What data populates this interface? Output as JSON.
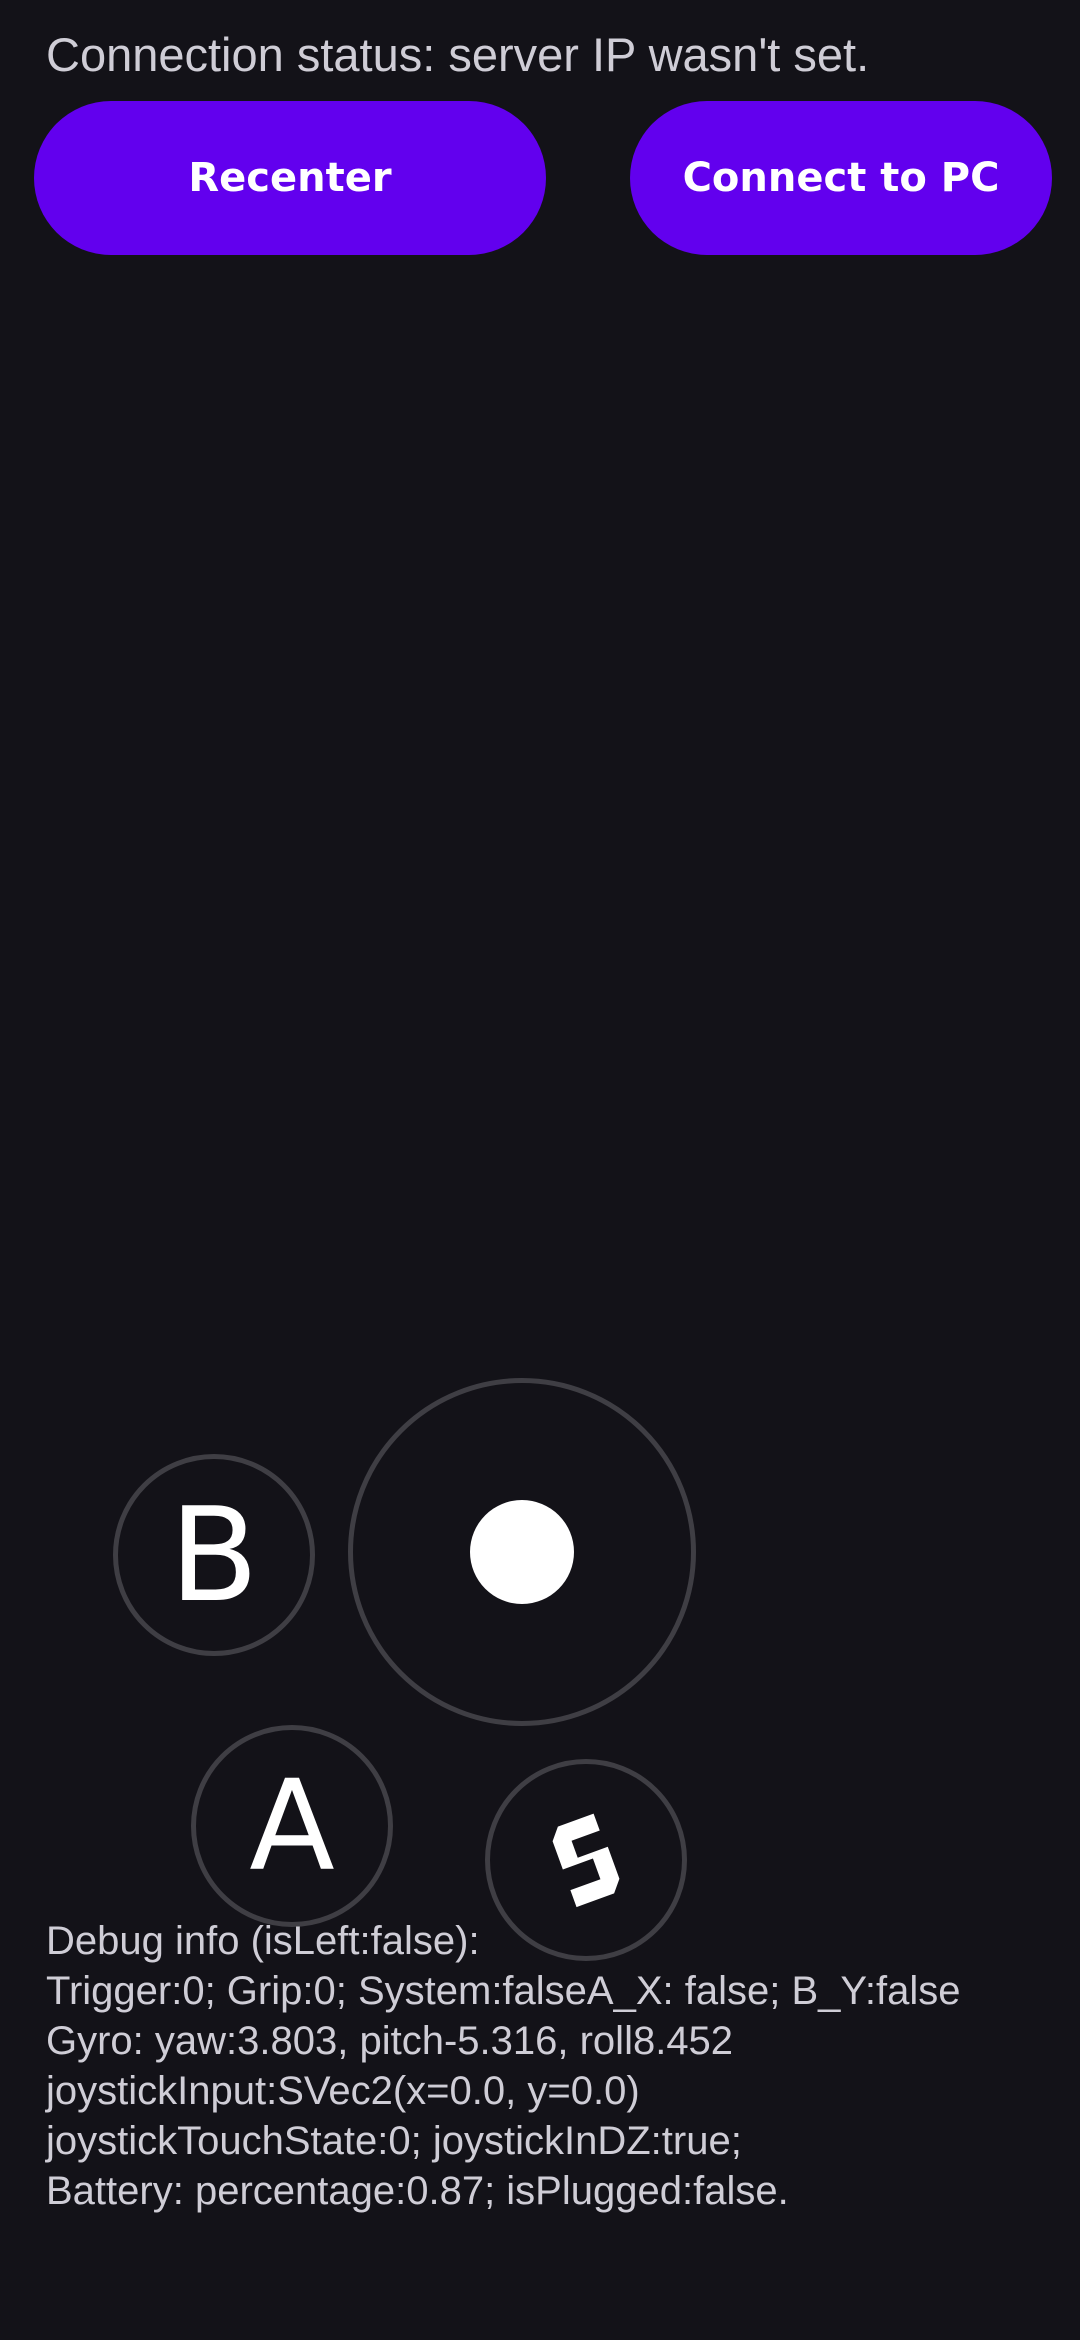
{
  "status": {
    "text": "Connection status: server IP wasn't set."
  },
  "buttons": {
    "recenter_label": "Recenter",
    "connect_label": "Connect to PC"
  },
  "controller": {
    "b_label": "B",
    "a_label": "A",
    "s_icon": "s-logo-icon",
    "joystick_knob_icon": "joystick-knob"
  },
  "debug": {
    "lines": [
      "Debug info (isLeft:false):",
      "Trigger:0; Grip:0; System:falseA_X: false; B_Y:false",
      "Gyro: yaw:3.803, pitch-5.316, roll8.452",
      "joystickInput:SVec2(x=0.0, y=0.0)",
      "joystickTouchState:0; joystickInDZ:true;",
      "Battery: percentage:0.87; isPlugged:false."
    ]
  },
  "colors": {
    "background": "#131218",
    "accent": "#6200ee",
    "text": "#cfcdd6",
    "ring": "#3f3e44"
  }
}
